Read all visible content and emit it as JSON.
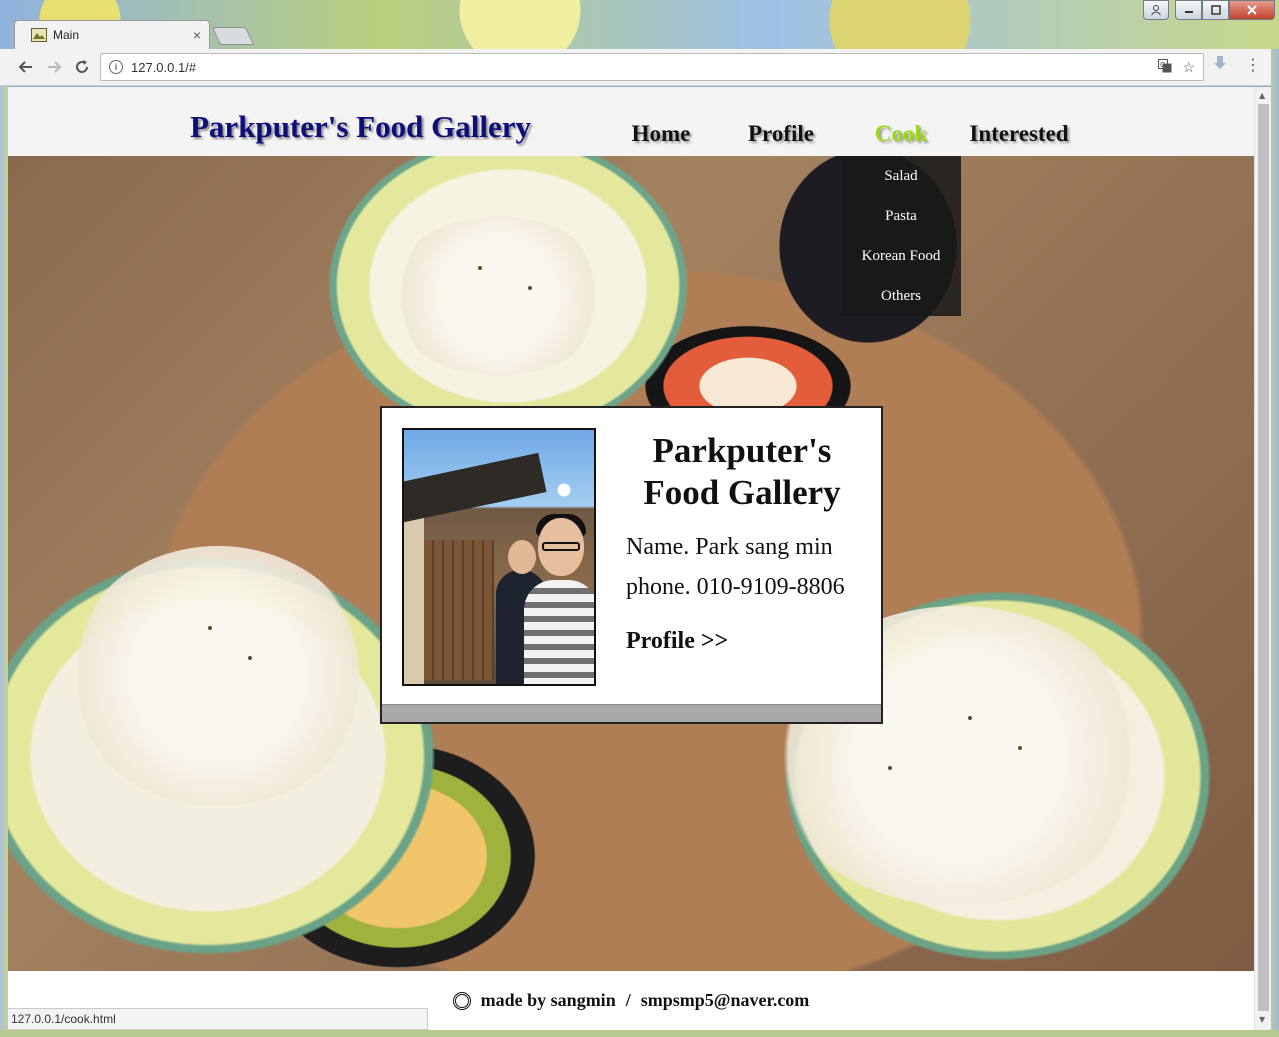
{
  "browser": {
    "tab_title": "Main",
    "tab_close": "×",
    "url": "127.0.0.1/#",
    "status_url": "127.0.0.1/cook.html",
    "icons": [
      "favicon-icon",
      "info-icon",
      "translate-icon",
      "star-icon",
      "download-icon",
      "menu-icon",
      "back-icon",
      "forward-icon",
      "reload-icon",
      "user-icon",
      "minimize-icon",
      "maximize-icon",
      "close-icon"
    ]
  },
  "site": {
    "title": "Parkputer's Food Gallery",
    "nav": [
      {
        "label": "Home"
      },
      {
        "label": "Profile"
      },
      {
        "label": "Cook",
        "active": true
      },
      {
        "label": "Interested"
      }
    ],
    "active_color": "#9bd81a",
    "cook_menu": [
      "Salad",
      "Pasta",
      "Korean Food",
      "Others"
    ]
  },
  "card": {
    "title_line1": "Parkputer's",
    "title_line2": "Food Gallery",
    "name": "Name. Park sang min",
    "phone": "phone. 010-9109-8806",
    "profile_link": "Profile >>"
  },
  "footer": {
    "made_by": "made by sangmin",
    "separator": "/",
    "email": "smpsmp5@naver.com"
  }
}
